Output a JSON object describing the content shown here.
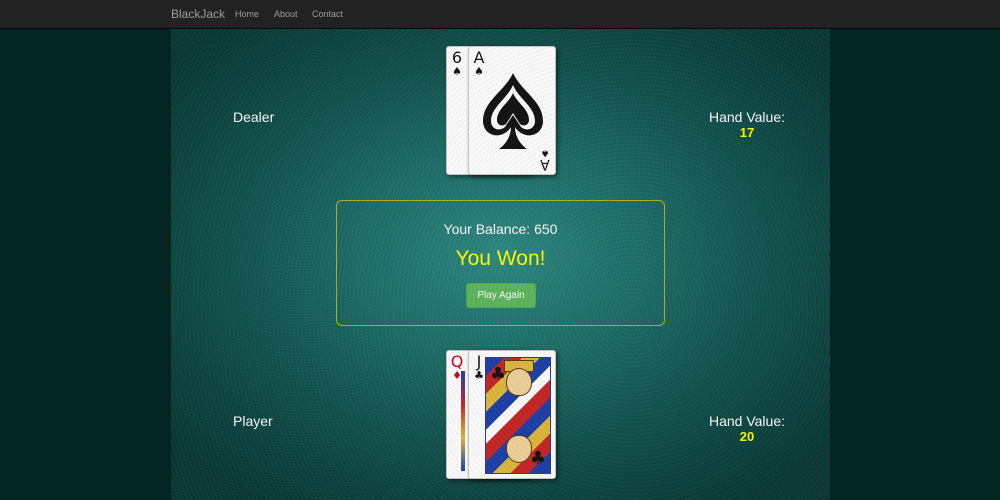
{
  "nav": {
    "brand": "BlackJack",
    "links": [
      "Home",
      "About",
      "Contact"
    ]
  },
  "dealer": {
    "label": "Dealer",
    "hand_value_label": "Hand Value:",
    "hand_value": "17",
    "cards": [
      {
        "rank": "6",
        "suit": "♠",
        "color": "black"
      },
      {
        "rank": "A",
        "suit": "♠",
        "color": "black"
      }
    ]
  },
  "player": {
    "label": "Player",
    "hand_value_label": "Hand Value:",
    "hand_value": "20",
    "cards": [
      {
        "rank": "Q",
        "suit": "♦",
        "color": "red"
      },
      {
        "rank": "J",
        "suit": "♣",
        "color": "black"
      }
    ]
  },
  "panel": {
    "balance_text": "Your Balance: 650",
    "result_text": "You Won!",
    "button_label": "Play Again"
  },
  "colors": {
    "navbar": "#222222",
    "felt": "#1d6d67",
    "result": "#ffff00",
    "hand_value": "#ffff00",
    "button": "#5cb85c",
    "panel_border": "#b0b327"
  }
}
